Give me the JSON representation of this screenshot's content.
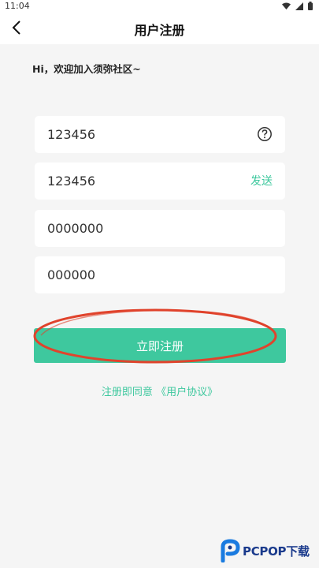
{
  "status_bar": {
    "time": "11:04"
  },
  "header": {
    "title": "用户注册"
  },
  "greeting": "Hi，欢迎加入须弥社区~",
  "form": {
    "phone_value": "123456",
    "code_value": "123456",
    "send_label": "发送",
    "password_value": "0000000",
    "confirm_value": "000000"
  },
  "register_button": {
    "label": "立即注册"
  },
  "agreement": {
    "prefix": "注册即同意",
    "link": "《用户协议》"
  },
  "watermark": {
    "text": "PCPOP下载"
  },
  "colors": {
    "accent": "#3ec89e",
    "annotation": "#e0432c",
    "background": "#f5f5f5"
  }
}
